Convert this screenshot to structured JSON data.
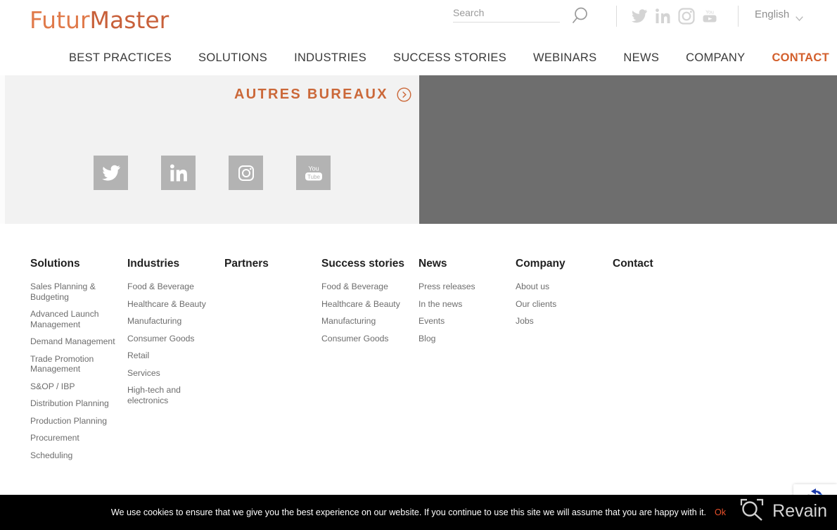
{
  "header": {
    "logo_text": "FuturMaster",
    "logo_part_a": "Futur",
    "logo_part_b": "Master",
    "logo_color": "#d86a3c",
    "search": {
      "placeholder": "Search",
      "value": "",
      "icon": "search-icon"
    },
    "social": [
      {
        "name": "twitter-icon",
        "label": "Twitter"
      },
      {
        "name": "linkedin-icon",
        "label": "LinkedIn"
      },
      {
        "name": "instagram-icon",
        "label": "Instagram"
      },
      {
        "name": "youtube-icon",
        "label": "YouTube"
      }
    ],
    "language": {
      "selected": "English",
      "icon": "chevron-down-icon"
    },
    "nav": [
      {
        "label": "BEST PRACTICES",
        "active": false
      },
      {
        "label": "SOLUTIONS",
        "active": false
      },
      {
        "label": "INDUSTRIES",
        "active": false
      },
      {
        "label": "SUCCESS STORIES",
        "active": false
      },
      {
        "label": "WEBINARS",
        "active": false
      },
      {
        "label": "NEWS",
        "active": false
      },
      {
        "label": "COMPANY",
        "active": false
      }
    ],
    "contact": {
      "label": "CONTACT",
      "color": "#d35f2c",
      "icon": "phone-icon"
    }
  },
  "banner": {
    "left_panel_color": "#f2f2f2",
    "right_panel_color": "#6e6e6e",
    "autres_bureaux": {
      "label": "AUTRES BUREAUX",
      "color": "#cb6839",
      "icon": "circle-arrow-right-icon"
    },
    "social_buttons": [
      {
        "name": "twitter-icon",
        "label": "Twitter"
      },
      {
        "name": "linkedin-icon",
        "label": "LinkedIn"
      },
      {
        "name": "instagram-icon",
        "label": "Instagram"
      },
      {
        "name": "youtube-icon",
        "label": "YouTube"
      }
    ]
  },
  "footer": {
    "columns": [
      {
        "title": "Solutions",
        "links": [
          "Sales Planning & Budgeting",
          "Advanced Launch Management",
          "Demand Management",
          "Trade Promotion Management",
          "S&OP / IBP",
          "Distribution Planning",
          "Production Planning",
          "Procurement",
          "Scheduling"
        ]
      },
      {
        "title": "Industries",
        "links": [
          "Food & Beverage",
          "Healthcare & Beauty",
          "Manufacturing",
          "Consumer Goods",
          "Retail",
          "Services",
          "High-tech and electronics"
        ]
      },
      {
        "title": "Partners",
        "links": []
      },
      {
        "title": "Success stories",
        "links": [
          "Food & Beverage",
          "Healthcare & Beauty",
          "Manufacturing",
          "Consumer Goods"
        ]
      },
      {
        "title": "News",
        "links": [
          "Press releases",
          "In the news",
          "Events",
          "Blog"
        ]
      },
      {
        "title": "Company",
        "links": [
          "About us",
          "Our clients",
          "Jobs"
        ]
      },
      {
        "title": "Contact",
        "links": []
      }
    ]
  },
  "cookie_bar": {
    "message": "We use cookies to ensure that we give you the best experience on our website. If you continue to use this site we will assume that you are happy with it.",
    "accept_label": "Ok",
    "accept_color": "#e8502a",
    "background": "#000000"
  },
  "watermark": {
    "label": "Revain",
    "icon": "revain-camera-icon"
  },
  "recaptcha": {
    "icon": "recaptcha-badge-icon"
  }
}
